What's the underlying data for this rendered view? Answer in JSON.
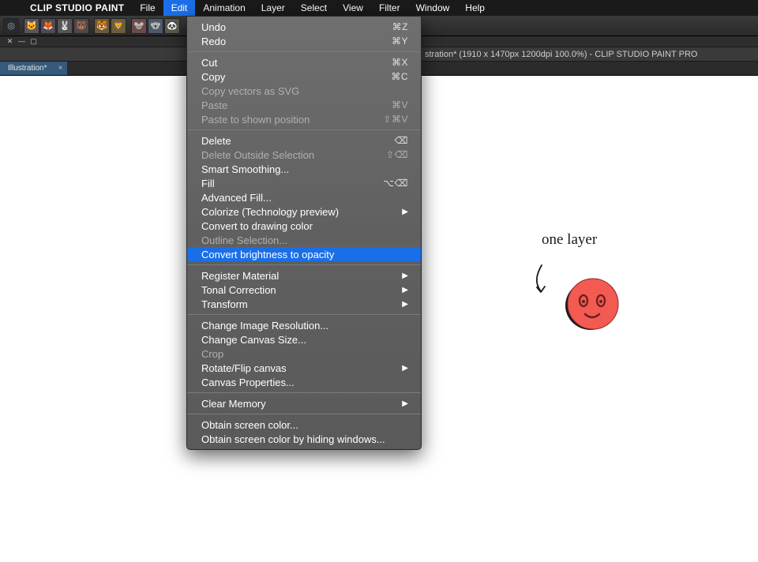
{
  "menubar": {
    "app": "CLIP STUDIO PAINT",
    "items": [
      "File",
      "Edit",
      "Animation",
      "Layer",
      "Select",
      "View",
      "Filter",
      "Window",
      "Help"
    ],
    "active": "Edit"
  },
  "titlebar": {
    "visible_fragment": "stration* (1910 x 1470px 1200dpi 100.0%)  -  CLIP STUDIO PAINT PRO"
  },
  "tab": {
    "label": "Illustration*"
  },
  "dropdown": {
    "sections": [
      [
        {
          "label": "Undo",
          "shortcut": "⌘Z",
          "enabled": true
        },
        {
          "label": "Redo",
          "shortcut": "⌘Y",
          "enabled": true
        }
      ],
      [
        {
          "label": "Cut",
          "shortcut": "⌘X",
          "enabled": true
        },
        {
          "label": "Copy",
          "shortcut": "⌘C",
          "enabled": true
        },
        {
          "label": "Copy vectors as SVG",
          "shortcut": "",
          "enabled": false
        },
        {
          "label": "Paste",
          "shortcut": "⌘V",
          "enabled": false
        },
        {
          "label": "Paste to shown position",
          "shortcut": "⇧⌘V",
          "enabled": false
        }
      ],
      [
        {
          "label": "Delete",
          "shortcut": "⌫",
          "enabled": true
        },
        {
          "label": "Delete Outside Selection",
          "shortcut": "⇧⌫",
          "enabled": false
        },
        {
          "label": "Smart Smoothing...",
          "shortcut": "",
          "enabled": true
        },
        {
          "label": "Fill",
          "shortcut": "⌥⌫",
          "enabled": true
        },
        {
          "label": "Advanced Fill...",
          "shortcut": "",
          "enabled": true
        },
        {
          "label": "Colorize (Technology preview)",
          "shortcut": "▶",
          "enabled": true
        },
        {
          "label": "Convert to drawing color",
          "shortcut": "",
          "enabled": true
        },
        {
          "label": "Outline Selection...",
          "shortcut": "",
          "enabled": false
        },
        {
          "label": "Convert brightness to opacity",
          "shortcut": "",
          "enabled": true,
          "highlight": true
        }
      ],
      [
        {
          "label": "Register Material",
          "shortcut": "▶",
          "enabled": true
        },
        {
          "label": "Tonal Correction",
          "shortcut": "▶",
          "enabled": true
        },
        {
          "label": "Transform",
          "shortcut": "▶",
          "enabled": true
        }
      ],
      [
        {
          "label": "Change Image Resolution...",
          "shortcut": "",
          "enabled": true
        },
        {
          "label": "Change Canvas Size...",
          "shortcut": "",
          "enabled": true
        },
        {
          "label": "Crop",
          "shortcut": "",
          "enabled": false
        },
        {
          "label": "Rotate/Flip canvas",
          "shortcut": "▶",
          "enabled": true
        },
        {
          "label": "Canvas Properties...",
          "shortcut": "",
          "enabled": true
        }
      ],
      [
        {
          "label": "Clear Memory",
          "shortcut": "▶",
          "enabled": true
        }
      ],
      [
        {
          "label": "Obtain screen color...",
          "shortcut": "",
          "enabled": true
        },
        {
          "label": "Obtain screen color by hiding windows...",
          "shortcut": "",
          "enabled": true
        }
      ]
    ]
  },
  "canvas": {
    "annotation_text": "one layer"
  }
}
